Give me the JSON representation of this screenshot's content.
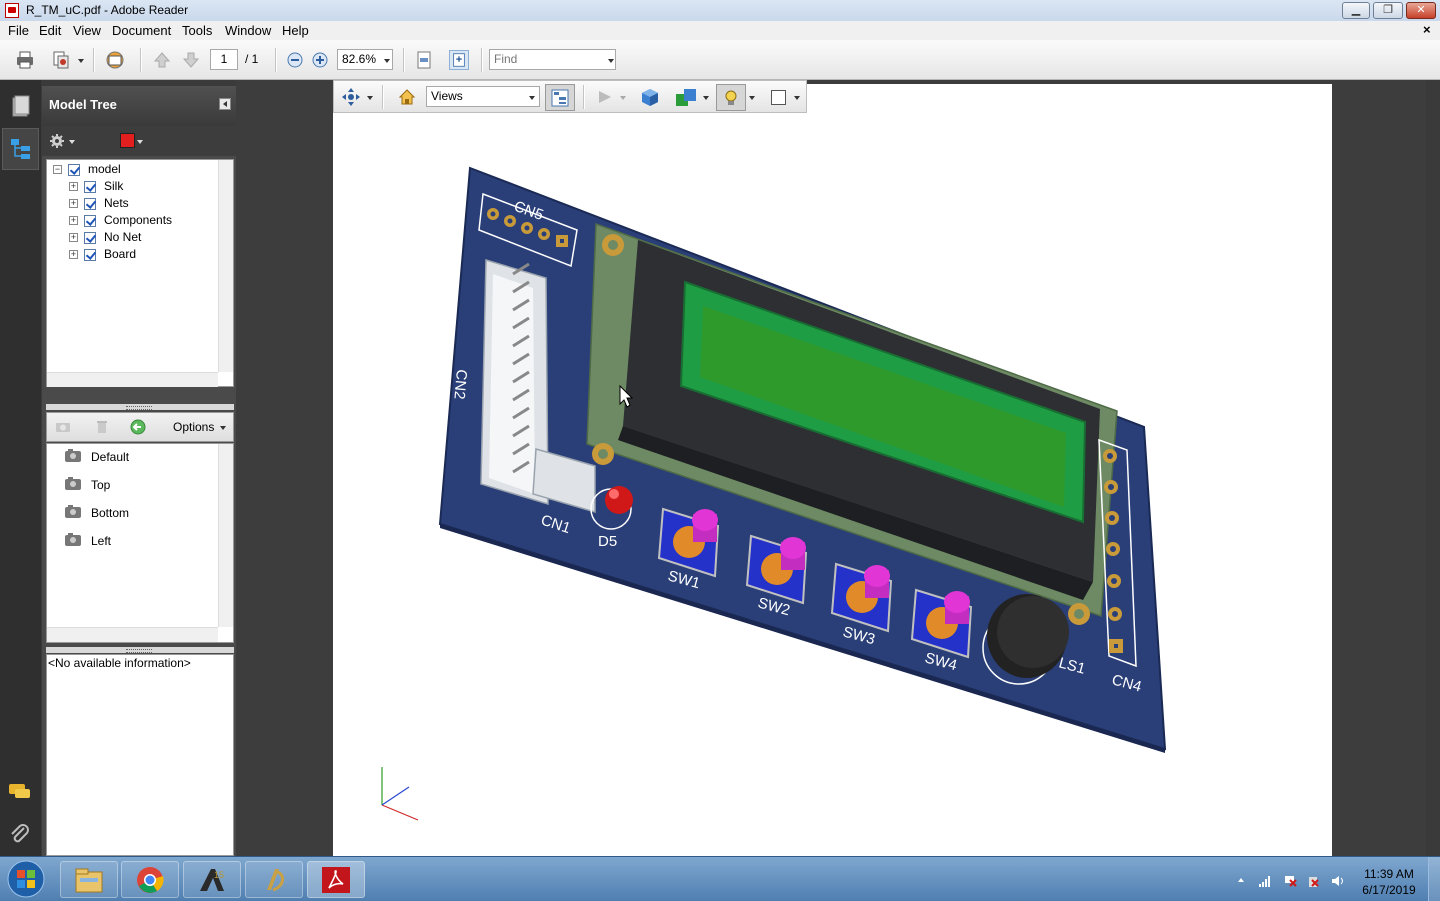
{
  "window": {
    "title": "R_TM_uC.pdf - Adobe Reader",
    "min_label": "▁",
    "max_label": "❐",
    "close_label": "✕"
  },
  "menu": {
    "items": [
      "File",
      "Edit",
      "View",
      "Document",
      "Tools",
      "Window",
      "Help"
    ],
    "close_doc": "×"
  },
  "toolbar": {
    "page_current": "1",
    "page_total": "/ 1",
    "zoom": "82.6%",
    "find_placeholder": "Find"
  },
  "model_tree": {
    "title": "Model Tree",
    "root": "model",
    "children": [
      "Silk",
      "Nets",
      "Components",
      "No Net",
      "Board"
    ],
    "options_label": "Options",
    "views": [
      "Default",
      "Top",
      "Bottom",
      "Left"
    ],
    "info_text": "<No available information>"
  },
  "toolbar3d": {
    "views_select": "Views"
  },
  "pcb_labels": {
    "cn5": "CN5",
    "cn2": "CN2",
    "cn1": "CN1",
    "d5": "D5",
    "sw1": "SW1",
    "sw2": "SW2",
    "sw3": "SW3",
    "sw4": "SW4",
    "ls1": "LS1",
    "cn4": "CN4"
  },
  "taskbar": {
    "time": "11:39 AM",
    "date": "6/17/2019",
    "apps": [
      "windows-explorer",
      "chrome",
      "altium-designer",
      "altium-viewer",
      "adobe-reader"
    ]
  },
  "colors": {
    "board": "#2a3f78",
    "silk": "#ffffff",
    "lcd_bezel": "#2d2f33",
    "lcd_screen": "#2e9a2c",
    "button_cap": "#e135d6",
    "pads": "#c89a3a",
    "module_pcb": "#6e8a64"
  }
}
